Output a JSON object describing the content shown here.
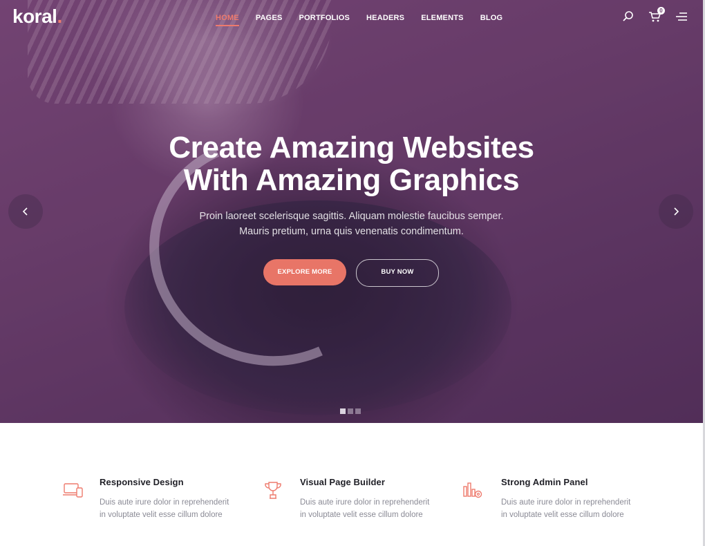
{
  "brand": {
    "logo_text": "koral",
    "logo_dot": ".",
    "accent_color": "#ee7a6d"
  },
  "nav": {
    "items": [
      {
        "label": "HOME",
        "active": true
      },
      {
        "label": "PAGES",
        "active": false
      },
      {
        "label": "PORTFOLIOS",
        "active": false
      },
      {
        "label": "HEADERS",
        "active": false
      },
      {
        "label": "ELEMENTS",
        "active": false
      },
      {
        "label": "BLOG",
        "active": false
      }
    ]
  },
  "tools": {
    "search_icon": "search-icon",
    "cart_icon": "cart-icon",
    "cart_count": "0",
    "menu_icon": "hamburger-menu-icon"
  },
  "hero": {
    "title_line1": "Create Amazing Websites",
    "title_line2": "With Amazing Graphics",
    "subtitle_line1": "Proin laoreet scelerisque sagittis. Aliquam molestie faucibus semper.",
    "subtitle_line2": "Mauris pretium, urna quis venenatis condimentum.",
    "primary_button": "EXPLORE MORE",
    "secondary_button": "BUY NOW",
    "slide_count": 3,
    "active_slide": 1
  },
  "features": [
    {
      "icon": "responsive-devices-icon",
      "title": "Responsive Design",
      "desc_line1": "Duis aute irure dolor in reprehenderit",
      "desc_line2": "in voluptate velit esse cillum dolore"
    },
    {
      "icon": "trophy-icon",
      "title": "Visual Page Builder",
      "desc_line1": "Duis aute irure dolor in reprehenderit",
      "desc_line2": "in voluptate velit esse cillum dolore"
    },
    {
      "icon": "admin-settings-icon",
      "title": "Strong Admin Panel",
      "desc_line1": "Duis aute irure dolor in reprehenderit",
      "desc_line2": "in voluptate velit esse cillum dolore"
    }
  ]
}
